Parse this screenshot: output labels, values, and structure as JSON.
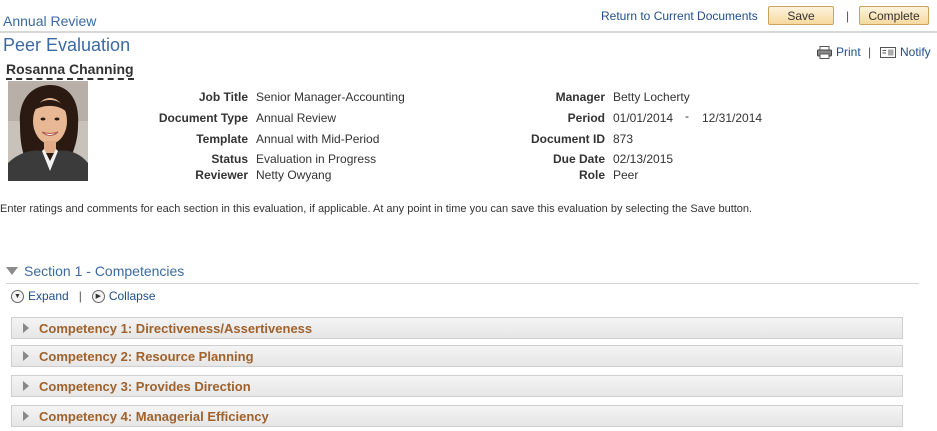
{
  "header": {
    "breadcrumb": "Annual Review",
    "return_link": "Return to Current Documents",
    "save_label": "Save",
    "separator": "|",
    "complete_label": "Complete"
  },
  "page": {
    "title": "Peer Evaluation",
    "employee_name": "Rosanna Channing",
    "print_label": "Print",
    "notify_label": "Notify"
  },
  "details": {
    "job_title_label": "Job Title",
    "job_title": "Senior Manager-Accounting",
    "document_type_label": "Document Type",
    "document_type": "Annual Review",
    "template_label": "Template",
    "template": "Annual with Mid-Period",
    "status_label": "Status",
    "status": "Evaluation in Progress",
    "reviewer_label": "Reviewer",
    "reviewer": "Netty Owyang",
    "manager_label": "Manager",
    "manager": "Betty Locherty",
    "period_label": "Period",
    "period_start": "01/01/2014",
    "period_dash": "-",
    "period_end": "12/31/2014",
    "document_id_label": "Document ID",
    "document_id": "873",
    "due_date_label": "Due Date",
    "due_date": "02/13/2015",
    "role_label": "Role",
    "role": "Peer"
  },
  "instructions": "Enter ratings and comments for each section in this evaluation, if applicable. At any point in time you can save this evaluation by selecting the Save button.",
  "section": {
    "title": "Section 1 - Competencies",
    "expand_label": "Expand",
    "collapse_label": "Collapse",
    "separator": "|",
    "competencies": [
      "Competency 1: Directiveness/Assertiveness",
      "Competency 2: Resource Planning",
      "Competency 3: Provides Direction",
      "Competency 4: Managerial Efficiency"
    ]
  }
}
